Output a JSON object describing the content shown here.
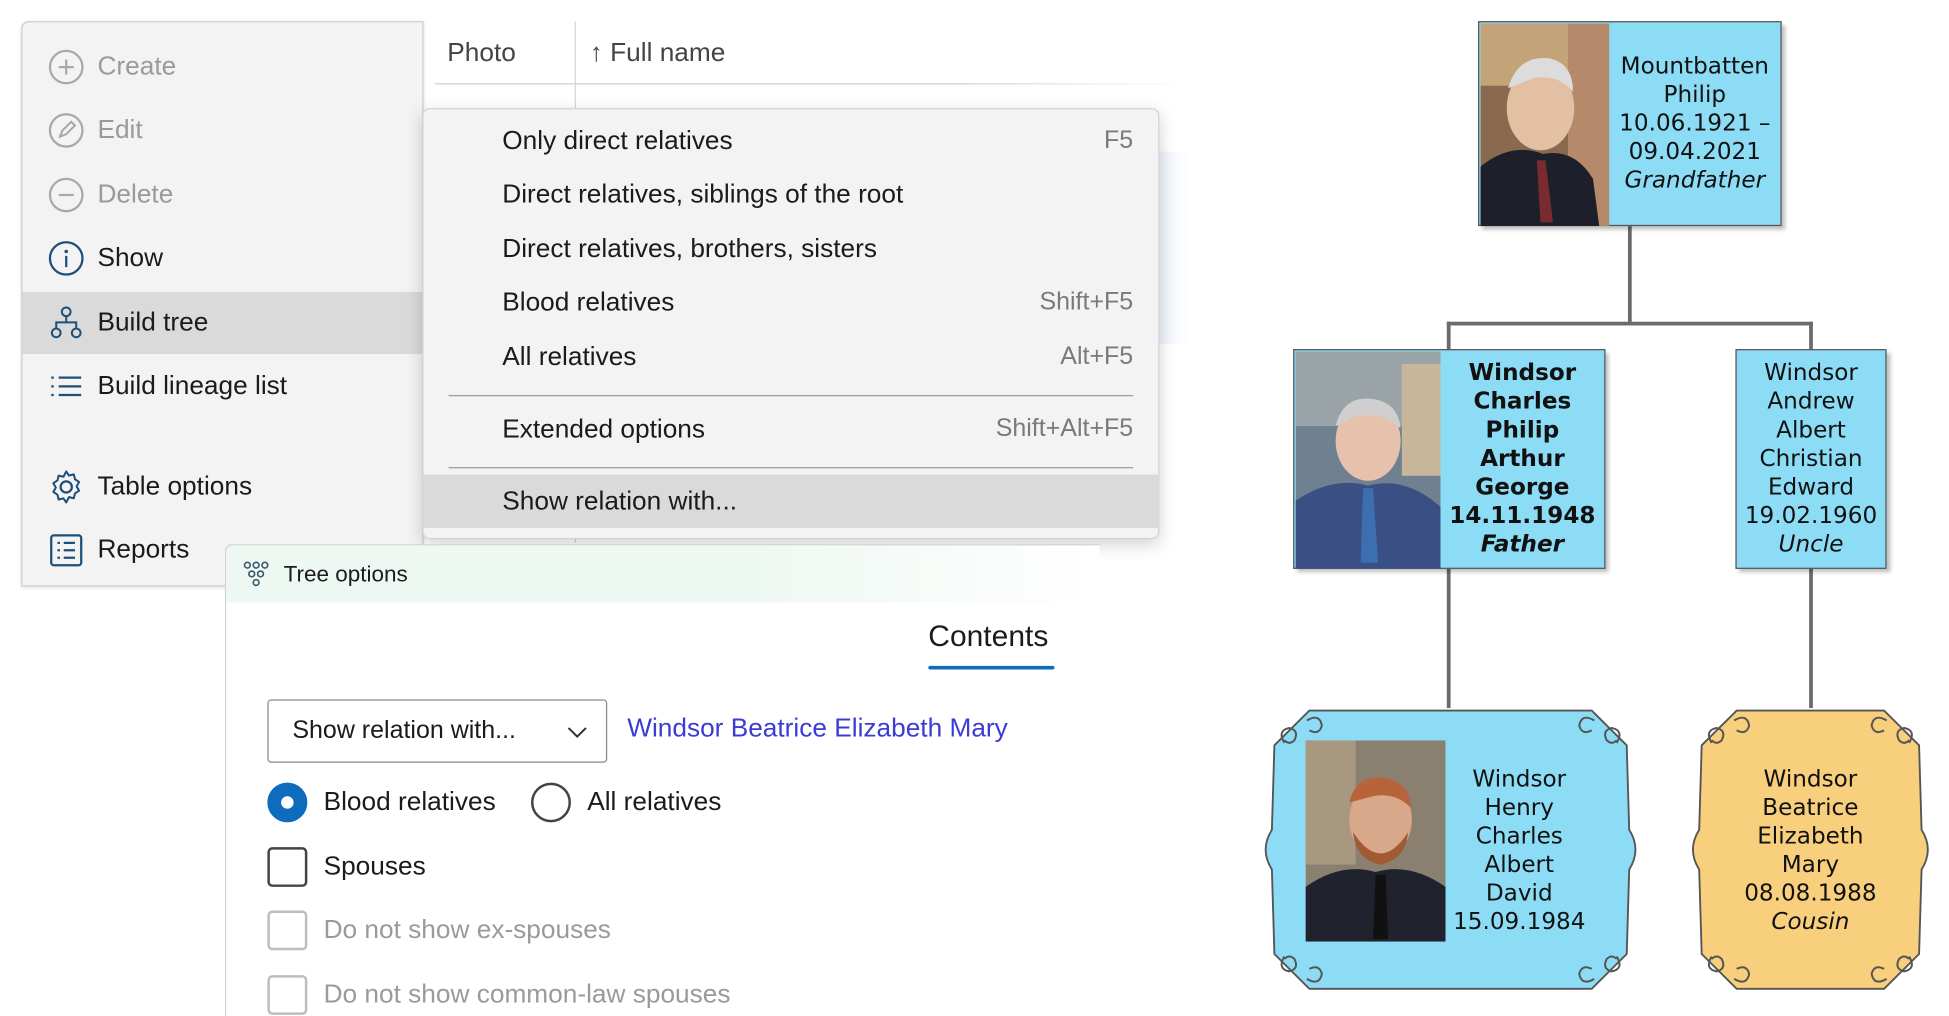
{
  "action_panel": {
    "items": [
      {
        "label": "Create",
        "icon": "plus-circle-icon",
        "state": "disabled"
      },
      {
        "label": "Edit",
        "icon": "pencil-circle-icon",
        "state": "disabled"
      },
      {
        "label": "Delete",
        "icon": "minus-circle-icon",
        "state": "disabled"
      },
      {
        "label": "Show",
        "icon": "info-circle-icon",
        "state": "enabled"
      },
      {
        "label": "Build tree",
        "icon": "tree-icon",
        "state": "selected"
      },
      {
        "label": "Build lineage list",
        "icon": "list-icon",
        "state": "enabled"
      },
      {
        "label": "Table options",
        "icon": "gear-icon",
        "state": "enabled"
      },
      {
        "label": "Reports",
        "icon": "report-icon",
        "state": "enabled"
      }
    ]
  },
  "table": {
    "columns": [
      "Photo",
      "↑ Full name"
    ]
  },
  "context_menu": {
    "items": [
      {
        "label": "Only direct relatives",
        "shortcut": "F5"
      },
      {
        "label": "Direct relatives, siblings of the root",
        "shortcut": ""
      },
      {
        "label": "Direct relatives, brothers, sisters",
        "shortcut": ""
      },
      {
        "label": "Blood relatives",
        "shortcut": "Shift+F5"
      },
      {
        "label": "All relatives",
        "shortcut": "Alt+F5"
      },
      {
        "label": "Extended options",
        "shortcut": "Shift+Alt+F5"
      },
      {
        "label": "Show relation with...",
        "shortcut": ""
      }
    ],
    "highlighted": "Show relation with..."
  },
  "tree_options": {
    "title": "Tree options",
    "title_icon": "tree-options-icon",
    "tab": "Contents",
    "mode_select": {
      "value": "Show relation with..."
    },
    "target_person": "Windsor Beatrice Elizabeth Mary",
    "radios": [
      {
        "label": "Blood relatives",
        "checked": true
      },
      {
        "label": "All relatives",
        "checked": false
      }
    ],
    "checkboxes": [
      {
        "label": "Spouses",
        "checked": false,
        "enabled": true
      },
      {
        "label": "Do not show ex-spouses",
        "checked": false,
        "enabled": false
      },
      {
        "label": "Do not show common-law spouses",
        "checked": false,
        "enabled": false
      }
    ]
  },
  "family_tree": {
    "colors": {
      "blue_card": "#8ddcf6",
      "orange_card": "#f8cf7c",
      "connector": "#6a6a6a"
    },
    "people": {
      "grandfather": {
        "lines": [
          "Mountbatten",
          "Philip",
          "10.06.1921 –",
          "09.04.2021"
        ],
        "role": "Grandfather",
        "has_photo": true
      },
      "father": {
        "lines": [
          "Windsor",
          "Charles",
          "Philip",
          "Arthur",
          "George",
          "14.11.1948"
        ],
        "role": "Father",
        "has_photo": true,
        "bold": true
      },
      "uncle": {
        "lines": [
          "Windsor",
          "Andrew",
          "Albert",
          "Christian",
          "Edward",
          "19.02.1960"
        ],
        "role": "Uncle",
        "has_photo": false
      },
      "self": {
        "lines": [
          "Windsor",
          "Henry",
          "Charles",
          "Albert",
          "David",
          "15.09.1984"
        ],
        "role": "",
        "has_photo": true
      },
      "cousin": {
        "lines": [
          "Windsor",
          "Beatrice",
          "Elizabeth",
          "Mary",
          "08.08.1988"
        ],
        "role": "Cousin",
        "has_photo": false
      }
    }
  }
}
